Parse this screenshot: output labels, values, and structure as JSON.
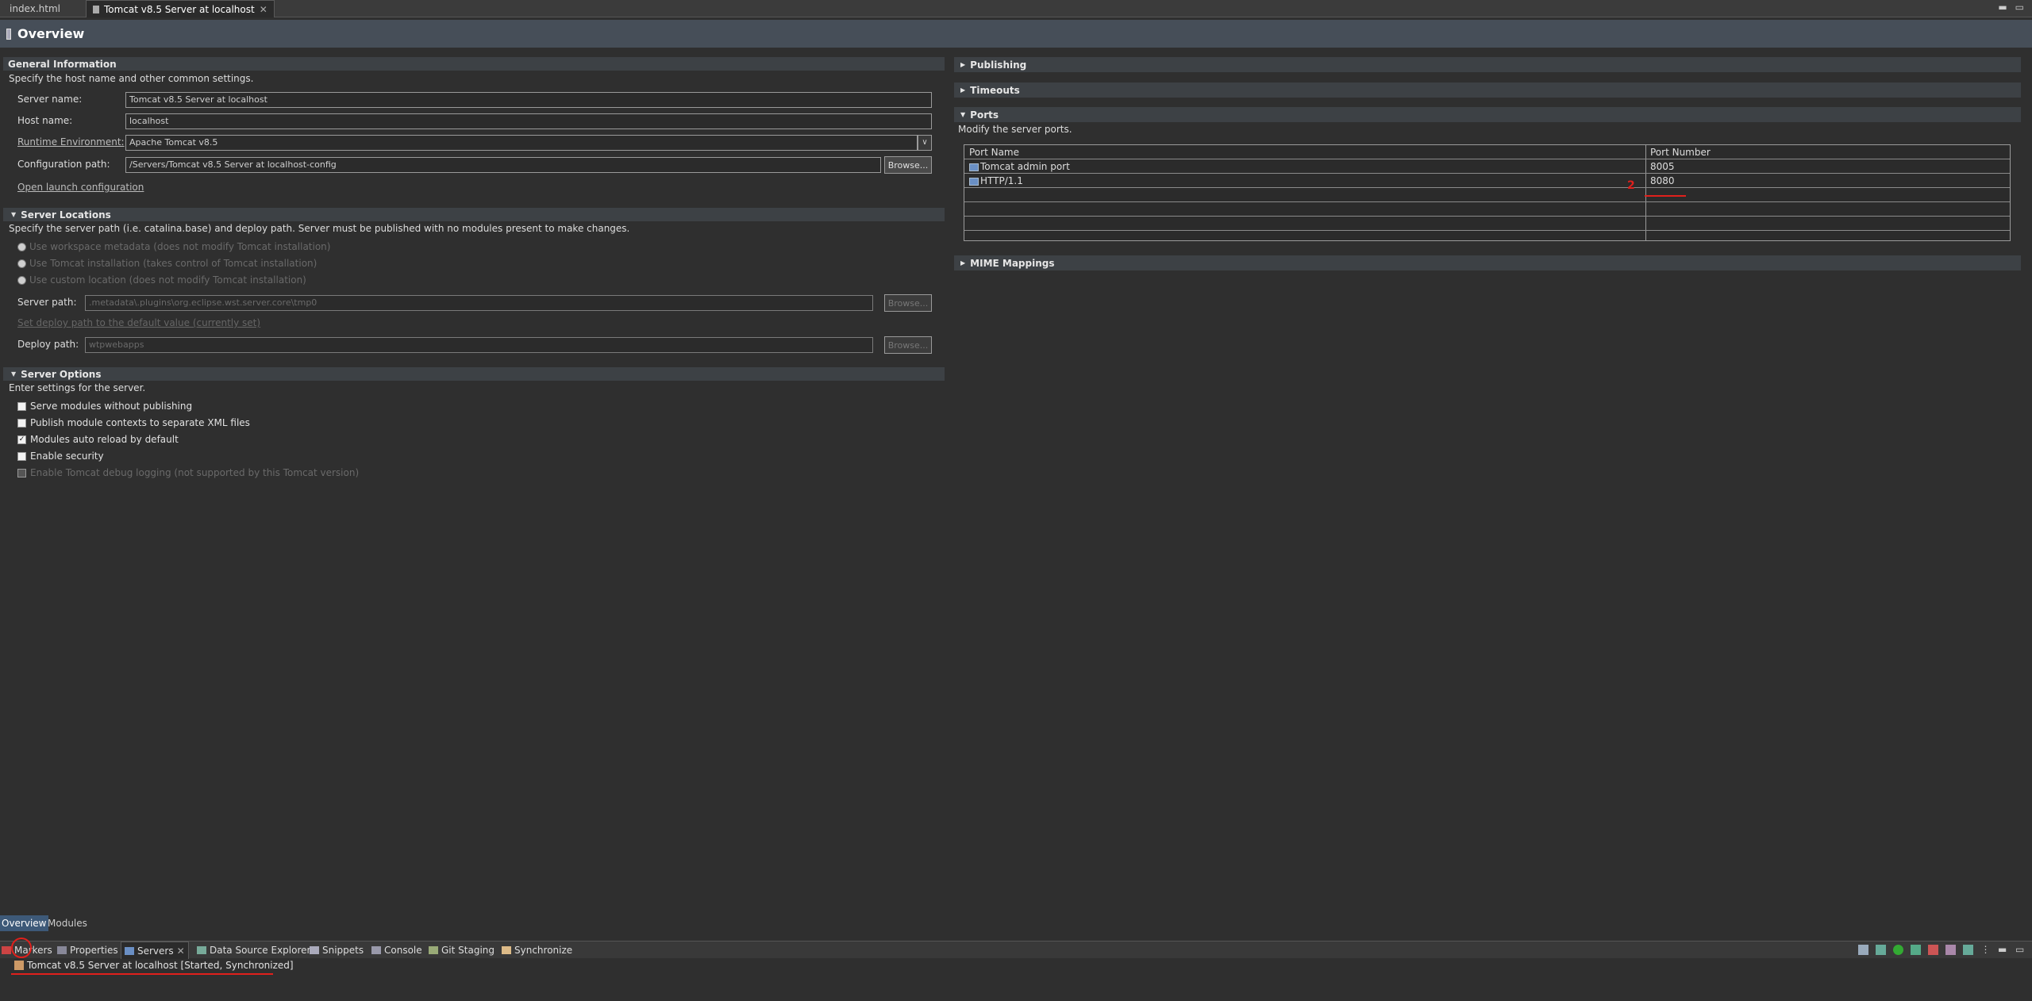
{
  "editor_tabs": [
    {
      "label": "index.html"
    },
    {
      "label": "Tomcat v8.5 Server at localhost"
    }
  ],
  "overview": {
    "title": "Overview"
  },
  "general": {
    "title": "General Information",
    "description": "Specify the host name and other common settings.",
    "server_name_label": "Server name:",
    "server_name_value": "Tomcat v8.5 Server at localhost",
    "host_name_label": "Host name:",
    "host_name_value": "localhost",
    "runtime_label": "Runtime Environment:",
    "runtime_value": "Apache Tomcat v8.5",
    "config_label": "Configuration path:",
    "config_value": "/Servers/Tomcat v8.5 Server at localhost-config",
    "browse_label": "Browse...",
    "open_launch": "Open launch configuration"
  },
  "locations": {
    "title": "Server Locations",
    "description": "Specify the server path (i.e. catalina.base) and deploy path. Server must be published with no modules present to make changes.",
    "radios": [
      "Use workspace metadata (does not modify Tomcat installation)",
      "Use Tomcat installation (takes control of Tomcat installation)",
      "Use custom location (does not modify Tomcat installation)"
    ],
    "server_path_label": "Server path:",
    "server_path_value": ".metadata\\.plugins\\org.eclipse.wst.server.core\\tmp0",
    "set_deploy_link": "Set deploy path to the default value (currently set)",
    "deploy_path_label": "Deploy path:",
    "deploy_path_value": "wtpwebapps",
    "browse_label": "Browse..."
  },
  "options": {
    "title": "Server Options",
    "description": "Enter settings for the server.",
    "checks": [
      {
        "label": "Serve modules without publishing",
        "checked": false
      },
      {
        "label": "Publish module contexts to separate XML files",
        "checked": false
      },
      {
        "label": "Modules auto reload by default",
        "checked": true
      },
      {
        "label": "Enable security",
        "checked": false
      },
      {
        "label": "Enable Tomcat debug logging (not supported by this Tomcat version)",
        "checked": false
      }
    ]
  },
  "right": {
    "publishing": "Publishing",
    "timeouts": "Timeouts",
    "ports_title": "Ports",
    "ports_desc": "Modify the server ports.",
    "mime": "MIME Mappings",
    "col_name": "Port Name",
    "col_number": "Port Number",
    "rows": [
      {
        "name": "Tomcat admin port",
        "number": "8005"
      },
      {
        "name": "HTTP/1.1",
        "number": "8080"
      }
    ],
    "annotation_mark": "2"
  },
  "bottom_tabs": {
    "overview": "Overview",
    "modules": "Modules"
  },
  "views": {
    "markers": "Markers",
    "properties": "Properties",
    "servers": "Servers",
    "dse": "Data Source Explorer",
    "snippets": "Snippets",
    "console": "Console",
    "git": "Git Staging",
    "sync": "Synchronize"
  },
  "server_entry": "Tomcat v8.5 Server at localhost  [Started, Synchronized]",
  "colors": {
    "accent": "#3d5978",
    "annotation": "#e0201c"
  }
}
